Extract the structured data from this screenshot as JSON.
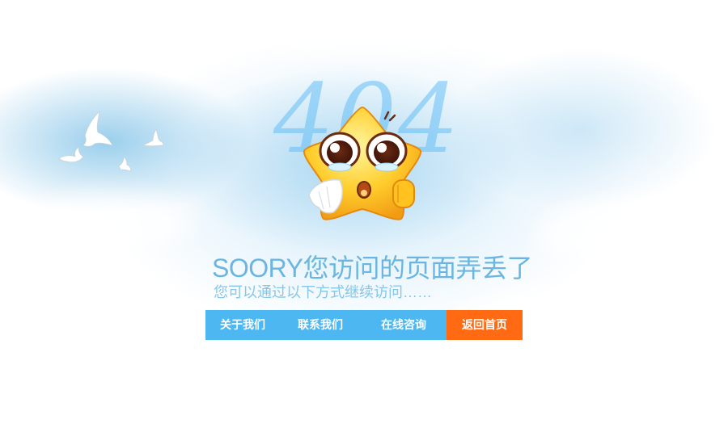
{
  "background_number": "404",
  "headline": "SOORY您访问的页面弄丢了",
  "subheadline": "您可以通过以下方式继续访问……",
  "nav": [
    {
      "label": "关于我们"
    },
    {
      "label": "联系我们"
    },
    {
      "label": "在线咨询"
    },
    {
      "label": "返回首页"
    }
  ],
  "colors": {
    "nav_bg": "#4db7f2",
    "home_button_bg": "#ff6a12",
    "headline": "#6ab6e0",
    "bg_number": "#64bef5"
  },
  "icons": [
    "crying-star-mascot-icon",
    "doves-icon"
  ]
}
